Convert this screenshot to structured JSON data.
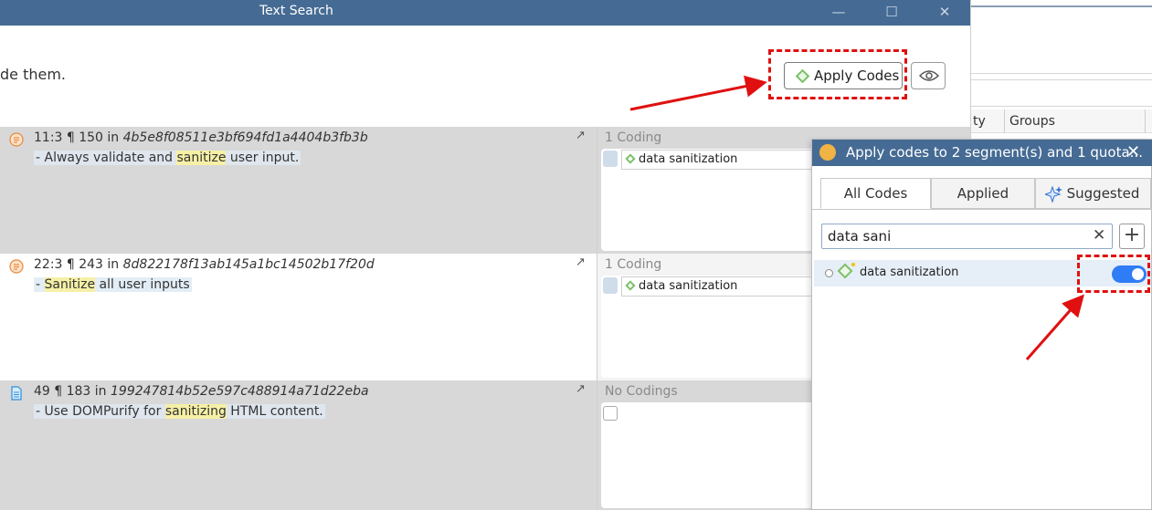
{
  "window": {
    "title": "Text Search",
    "controls": [
      "minimize",
      "maximize",
      "close"
    ]
  },
  "toolbar": {
    "instruction": "de them.",
    "apply_codes_label": "Apply Codes",
    "eye_icon": "eye-icon"
  },
  "background_window": {
    "col_partial": "ty",
    "col_groups": "Groups"
  },
  "results": [
    {
      "icon": "document-icon",
      "location": "11:3 ¶ 150",
      "in": "in",
      "source": "4b5e8f08511e3bf694fd1a4404b3fb3b",
      "text_pre": "- Always validate and ",
      "text_hl": "sanitize",
      "text_post": " user input.",
      "coding_count": "1 Coding",
      "code": "data sanitization"
    },
    {
      "icon": "document-icon",
      "location": "22:3 ¶ 243",
      "in": "in",
      "source": "8d822178f13ab145a1bc14502b17f20d",
      "text_pre": "- ",
      "text_hl": "Sanitize",
      "text_post": " all user inputs",
      "coding_count": "1 Coding",
      "code": "data sanitization"
    },
    {
      "icon": "text-file-icon",
      "location": "49 ¶ 183",
      "in": "in",
      "source": "199247814b52e597c488914a71d22eba",
      "text_pre": "- Use DOMPurify for ",
      "text_hl": "sanitizing",
      "text_post": " HTML content.",
      "coding_count": "No Codings",
      "code": ""
    }
  ],
  "panel": {
    "title": "Apply codes to 2 segment(s) and 1 quota...",
    "close": "✕",
    "tabs": [
      "All Codes",
      "Applied",
      "Suggested"
    ],
    "search_value": "data sani",
    "clear": "✕",
    "add": "+",
    "code_item": "data sanitization",
    "toggle_on": true,
    "accent": "#2e7cf6"
  },
  "colors": {
    "titlebar": "#456b94",
    "highlight": "#f6f0a6",
    "annotation_red": "#e01010"
  }
}
